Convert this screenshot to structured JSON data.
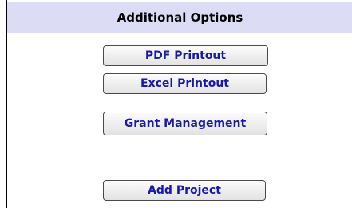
{
  "panel": {
    "title": "Additional Options",
    "buttons": {
      "pdf": "PDF Printout",
      "excel": "Excel Printout",
      "grant": "Grant Management",
      "add_project": "Add Project"
    }
  },
  "colors": {
    "header_bg": "#dcdcf4",
    "button_text": "#1a1aa6",
    "border": "#4a4a4a"
  }
}
